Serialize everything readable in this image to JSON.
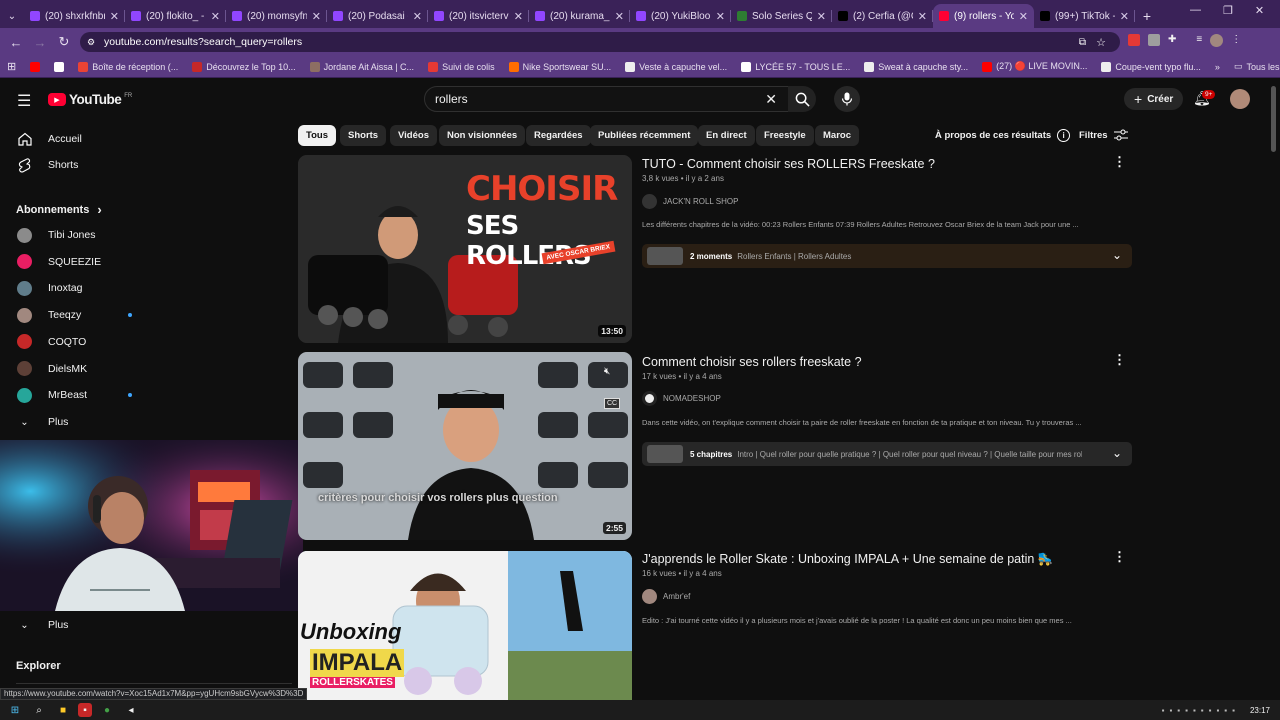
{
  "browser": {
    "tabs": [
      {
        "title": "(20) shxrkfnbr",
        "color": "#9146ff"
      },
      {
        "title": "(20) flokito_ - T",
        "color": "#9146ff"
      },
      {
        "title": "(20) momsyfnr",
        "color": "#9146ff"
      },
      {
        "title": "(20) Podasai -",
        "color": "#9146ff"
      },
      {
        "title": "(20) itsvicterv -",
        "color": "#9146ff"
      },
      {
        "title": "(20) kurama_2",
        "color": "#9146ff"
      },
      {
        "title": "(20) YukiBloo -",
        "color": "#9146ff"
      },
      {
        "title": "Solo Series Qu",
        "color": "#2e7d32"
      },
      {
        "title": "(2) Cerfia (@Ce",
        "color": "#000000"
      },
      {
        "title": "(9) rollers - You",
        "color": "#ff0033"
      },
      {
        "title": "(99+) TikTok - M",
        "color": "#000000"
      }
    ],
    "active_tab": 9,
    "new_tab": "+",
    "url": "youtube.com/results?search_query=rollers",
    "bookmarks": [
      {
        "label": "",
        "color": "#ff0000"
      },
      {
        "label": "",
        "color": "#ffffff"
      },
      {
        "label": "Boîte de réception (...",
        "color": "#ea4335"
      },
      {
        "label": "Découvrez le Top 10...",
        "color": "#c62828"
      },
      {
        "label": "Jordane Ait Aissa | C...",
        "color": "#8d6e63"
      },
      {
        "label": "Suivi de colis",
        "color": "#e53935"
      },
      {
        "label": "Nike Sportswear SU...",
        "color": "#ff6d00"
      },
      {
        "label": "Veste à capuche vel...",
        "color": "#eeeeee"
      },
      {
        "label": "LYCÉE 57 - TOUS LE...",
        "color": "#ffffff"
      },
      {
        "label": "Sweat à capuche sty...",
        "color": "#eeeeee"
      },
      {
        "label": "(27) 🔴 LIVE MOVIN...",
        "color": "#ff0000"
      },
      {
        "label": "Coupe-vent typo flu...",
        "color": "#eeeeee"
      }
    ],
    "bookmarks_more": "»",
    "all_bookmarks": "Tous les favoris",
    "status_url": "https://www.youtube.com/watch?v=Xoc15Ad1x7M&pp=ygUHcm9sbGVycw%3D%3D"
  },
  "youtube": {
    "logo": "YouTube",
    "region": "FR",
    "search_value": "rollers",
    "create_label": "Créer",
    "notif_badge": "9+",
    "sidebar": {
      "home": "Accueil",
      "shorts": "Shorts",
      "subs_header": "Abonnements",
      "subs_chevron": "›",
      "subscriptions": [
        {
          "name": "Tibi Jones",
          "color": "#8b8b8b",
          "live": false
        },
        {
          "name": "SQUEEZIE",
          "color": "#e91e63",
          "live": false
        },
        {
          "name": "Inoxtag",
          "color": "#607d8b",
          "live": false
        },
        {
          "name": "Teeqzy",
          "color": "#a1887f",
          "live": true
        },
        {
          "name": "COQTO",
          "color": "#c62828",
          "live": false
        },
        {
          "name": "DielsMK",
          "color": "#5d4037",
          "live": false
        },
        {
          "name": "MrBeast",
          "color": "#26a69a",
          "live": true
        }
      ],
      "more": "Plus",
      "more2": "Plus",
      "explore": "Explorer"
    },
    "chips": [
      "Tous",
      "Shorts",
      "Vidéos",
      "Non visionnées",
      "Regardées",
      "Publiées récemment",
      "En direct",
      "Freestyle",
      "Maroc"
    ],
    "about_results": "À propos de ces résultats",
    "filters": "Filtres",
    "results": [
      {
        "title": "TUTO - Comment choisir ses ROLLERS Freeskate ?",
        "meta": "3,8 k vues • il y a 2 ans",
        "channel": "JACK'N ROLL SHOP",
        "channel_color": "#333333",
        "desc": "Les différents chapitres de la vidéo: 00:23 Rollers Enfants 07:39 Rollers Adultes Retrouvez Oscar Briex de la team Jack pour une ...",
        "duration": "13:50",
        "thumb_text_1": "CHOISIR",
        "thumb_text_2": "SES ROLLERS",
        "thumb_tag": "AVEC OSCAR BRIEX",
        "chapters_count": "2 moments",
        "chapters_list": "Rollers Enfants | Rollers Adultes",
        "chapbar_color": "#2a1f14"
      },
      {
        "title": "Comment choisir ses rollers freeskate ?",
        "meta": "17 k vues • il y a 4 ans",
        "channel": "NOMADESHOP",
        "channel_color": "#222222",
        "desc": "Dans cette vidéo, on t'explique comment choisir ta paire de roller freeskate en fonction de ta pratique et ton niveau. Tu y trouveras ...",
        "duration": "2:55",
        "thumb_caption": "critères pour choisir vos rollers plus question",
        "thumb_cc": "CC",
        "chapters_count": "5 chapitres",
        "chapters_list": "Intro | Quel roller pour quelle pratique ? | Quel roller pour quel niveau ? | Quelle taille pour mes rollers | ...",
        "chapbar_color": "#272727"
      },
      {
        "title": "J'apprends le Roller Skate : Unboxing IMPALA + Une semaine de patin 🛼",
        "meta": "16 k vues • il y a 4 ans",
        "channel": "Ambr'ef",
        "channel_color": "#a1887f",
        "desc": "Edito : J'ai tourné cette vidéo il y a plusieurs mois et j'avais oublié de la poster ! La qualité est donc un peu moins bien que mes ...",
        "thumb_text_1": "Unboxing",
        "thumb_text_2": "IMPALA",
        "thumb_text_3": "ROLLERSKATES"
      }
    ]
  },
  "taskbar": {
    "time": "23:17"
  }
}
